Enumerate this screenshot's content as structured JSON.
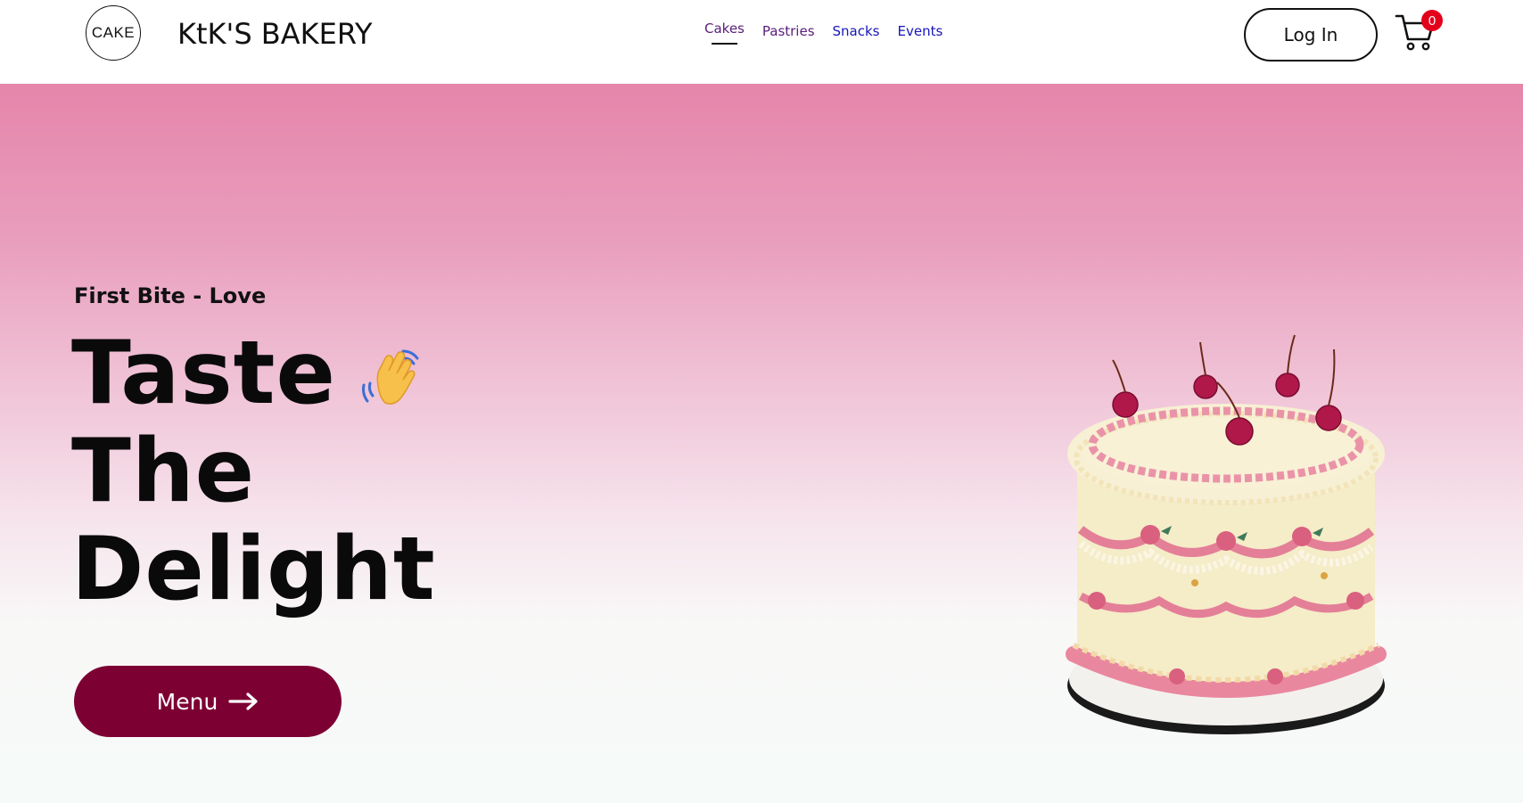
{
  "header": {
    "logo_text": "CAKE",
    "brand": "KtK'S BAKERY",
    "nav": {
      "cakes": "Cakes",
      "pastries": "Pastries",
      "snacks": "Snacks",
      "events": "Events"
    },
    "login_label": "Log In",
    "cart_count": "0",
    "cart_icon": "shopping-cart-icon"
  },
  "hero": {
    "tagline": "First Bite - Love",
    "headline": {
      "line1": "Taste",
      "line2": "The",
      "line3": "Delight"
    },
    "wave_icon": "waving-hand-icon",
    "menu_label": "Menu",
    "menu_icon": "arrow-right-icon",
    "image": "cake-image"
  },
  "colors": {
    "accent": "#7d0033",
    "hero_top": "#e585aa",
    "hero_bottom": "#f6faf8",
    "badge": "#e3001b",
    "nav_active": "#5a1d7a",
    "nav_link": "#1616b8"
  }
}
